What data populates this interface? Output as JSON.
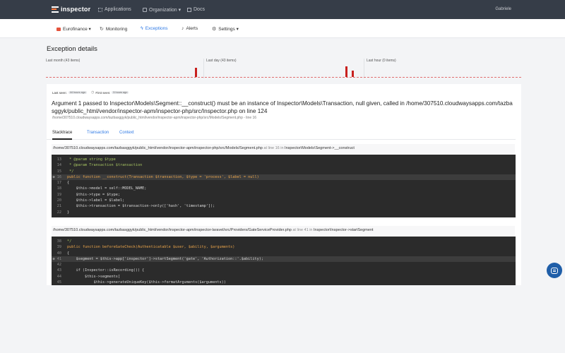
{
  "topbar": {
    "brand": "inspector",
    "nav": [
      {
        "label": "Applications",
        "icon": "grid-icon"
      },
      {
        "label": "Organization ▾",
        "icon": "building-icon"
      },
      {
        "label": "Docs",
        "icon": "book-icon"
      }
    ],
    "user": "Gabriele"
  },
  "subnav": {
    "app": "Eurofinance ▾",
    "items": [
      {
        "label": "Monitoring",
        "icon": "↻"
      },
      {
        "label": "Exceptions",
        "icon": "ϟ"
      },
      {
        "label": "Alerts",
        "icon": "♪"
      },
      {
        "label": "Settings ▾",
        "icon": "⚙"
      }
    ]
  },
  "page_title": "Exception details",
  "histograms": [
    {
      "label": "Last month (43 items)",
      "bars": [
        0.85
      ]
    },
    {
      "label": "Last day (43 items)",
      "bars": [
        1.0,
        0.6
      ]
    },
    {
      "label": "Last hour (0 items)",
      "bars": []
    }
  ],
  "seen": {
    "last_label": "Last seen:",
    "last_value": "44 hours ago",
    "first_label": "First seen:",
    "first_value": "5 hours ago"
  },
  "message": "Argument 1 passed to Inspector\\Models\\Segment::__construct() must be an instance of Inspector\\Models\\Transaction, null given, called in /home/307510.cloudwaysapps.com/tazbasggyk/public_html/vendor/inspector-apm/inspector-php/src/Inspector.php on line 124",
  "message_path": "/home/307510.cloudwaysapps.com/tazbasggyk/public_html/vendor/inspector-apm/inspector-php/src/Models/Segment.php - line 16",
  "tabs": [
    "Stacktrace",
    "Transaction",
    "Context"
  ],
  "frames": [
    {
      "path": "/home/307510.cloudwaysapps.com/tazbasggyk/public_html/vendor/inspector-apm/inspector-php/src/Models/Segment.php",
      "mid": " at line 16 in ",
      "fn": "Inspector\\Models\\Segment->__construct",
      "lines": [
        {
          "n": "13",
          "t": " * @param string $type"
        },
        {
          "n": "14",
          "t": " * @param Transaction $transaction"
        },
        {
          "n": "15",
          "t": " */"
        },
        {
          "n": "16",
          "t": "public function __construct(Transaction $transaction, $type = 'process', $label = null)",
          "hl": true
        },
        {
          "n": "17",
          "t": "{"
        },
        {
          "n": "18",
          "t": "    $this->model = self::MODEL_NAME;"
        },
        {
          "n": "19",
          "t": "    $this->type = $type;"
        },
        {
          "n": "20",
          "t": "    $this->label = $label;"
        },
        {
          "n": "21",
          "t": "    $this->transaction = $transaction->only(['hash', 'timestamp']);"
        },
        {
          "n": "22",
          "t": "}"
        }
      ]
    },
    {
      "path": "/home/307510.cloudwaysapps.com/tazbasggyk/public_html/vendor/inspector-apm/inspector-laravel/src/Providers/GateServiceProvider.php",
      "mid": " at line 41 in ",
      "fn": "Inspector\\Inspector->startSegment",
      "lines": [
        {
          "n": "38",
          "t": "*/"
        },
        {
          "n": "39",
          "t": "public function beforeGateCheck(Authenticatable $user, $ability, $arguments)"
        },
        {
          "n": "40",
          "t": "{"
        },
        {
          "n": "41",
          "t": "    $segment = $this->app['inspector']->startSegment('gate', 'Authorization::'.$ability);",
          "hl": true
        },
        {
          "n": "42",
          "t": ""
        },
        {
          "n": "43",
          "t": "    if (Inspector::isRecording()) {"
        },
        {
          "n": "44",
          "t": "        $this->segments["
        },
        {
          "n": "45",
          "t": "            $this->generateUniqueKey($this->formatArguments($arguments))"
        }
      ]
    }
  ]
}
